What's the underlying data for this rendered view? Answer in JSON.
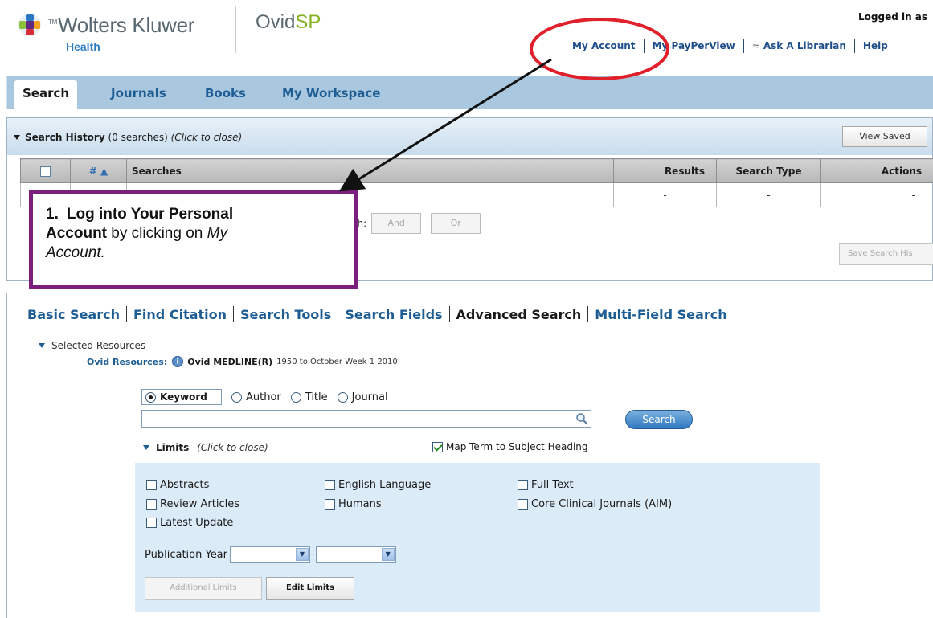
{
  "header": {
    "brand": "Wolters Kluwer",
    "brand_sub": "Health",
    "product_prefix": "Ovid",
    "product_suffix": "SP",
    "logged_in": "Logged in as",
    "links": {
      "my_account": "My Account",
      "pay_per_view": "My PayPerView",
      "ask_librarian": "Ask A Librarian",
      "help": "Help"
    },
    "librarian_icon": "person-question-icon"
  },
  "tabs": [
    "Search",
    "Journals",
    "Books",
    "My Workspace"
  ],
  "history": {
    "title": "Search History",
    "count": "(0 searches)",
    "close": "(Click to close)",
    "view_saved": "View Saved",
    "columns": {
      "num": "# ▲",
      "searches": "Searches",
      "results": "Results",
      "type": "Search Type",
      "actions": "Actions"
    },
    "empty_row": {
      "results": "-",
      "type": "-",
      "actions": "-"
    },
    "combine_label": "ns with:",
    "and": "And",
    "or": "Or",
    "save_history": "Save Search His"
  },
  "callout": {
    "num": "1.",
    "bold": "Log into Your Personal",
    "line2_bold": "Account",
    "line2_rest": " by clicking on ",
    "line2_it": "My",
    "line3_it": "Account",
    "line3_end": "."
  },
  "search_nav": [
    "Basic Search",
    "Find Citation",
    "Search Tools",
    "Search Fields",
    "Advanced Search",
    "Multi-Field Search"
  ],
  "resources": {
    "label": "Selected Resources",
    "ovid_label": "Ovid Resources:",
    "db": "Ovid MEDLINE(R)",
    "range": "1950 to October Week 1 2010"
  },
  "search": {
    "options": [
      "Keyword",
      "Author",
      "Title",
      "Journal"
    ],
    "selected": "Keyword",
    "button": "Search",
    "input_value": ""
  },
  "limits": {
    "title": "Limits",
    "close": "(Click to close)",
    "map_term": "Map Term to Subject Heading",
    "map_term_checked": true,
    "items": [
      "Abstracts",
      "English Language",
      "Full Text",
      "Review Articles",
      "Humans",
      "Core Clinical Journals (AIM)",
      "Latest Update"
    ],
    "pub_year_label": "Publication Year",
    "pub_year_from": "-",
    "pub_year_to": "-",
    "additional": "Additional Limits",
    "edit": "Edit Limits"
  },
  "colors": {
    "annotation_red": "#e0202a",
    "callout_border": "#7a1f7d",
    "link_blue": "#1d5d94"
  }
}
